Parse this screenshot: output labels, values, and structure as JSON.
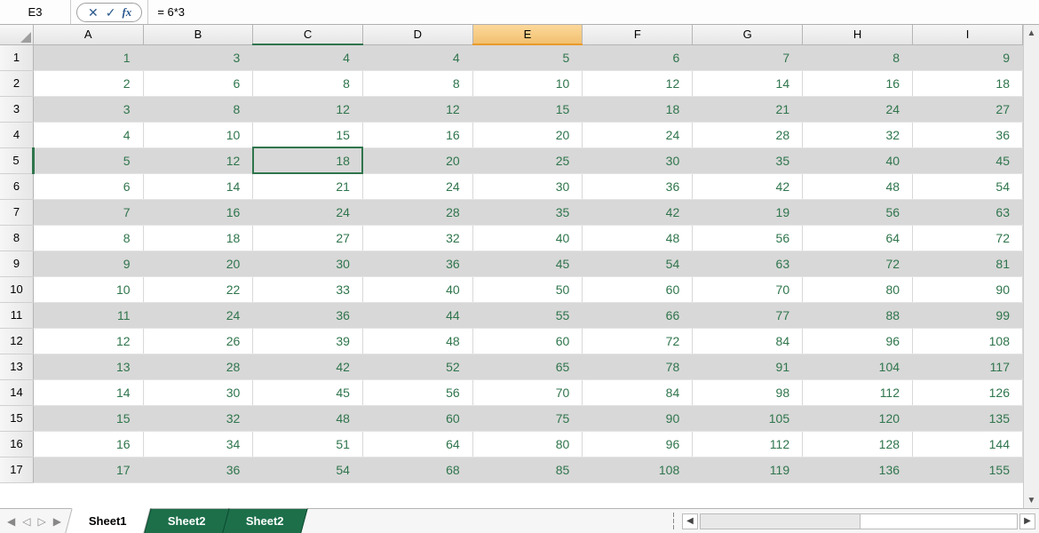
{
  "formulaBar": {
    "cellRef": "E3",
    "fxLabel": "fx",
    "formula": "= 6*3"
  },
  "columns": [
    "A",
    "B",
    "C",
    "D",
    "E",
    "F",
    "G",
    "H",
    "I"
  ],
  "highlightedCol": "E",
  "hintedCol": "C",
  "selectedCell": {
    "row": 5,
    "col": "C"
  },
  "hintedRow": 5,
  "rows": [
    {
      "n": 1,
      "cells": [
        "1",
        "3",
        "4",
        "4",
        "5",
        "6",
        "7",
        "8",
        "9"
      ]
    },
    {
      "n": 2,
      "cells": [
        "2",
        "6",
        "8",
        "8",
        "10",
        "12",
        "14",
        "16",
        "18"
      ]
    },
    {
      "n": 3,
      "cells": [
        "3",
        "8",
        "12",
        "12",
        "15",
        "18",
        "21",
        "24",
        "27"
      ]
    },
    {
      "n": 4,
      "cells": [
        "4",
        "10",
        "15",
        "16",
        "20",
        "24",
        "28",
        "32",
        "36"
      ]
    },
    {
      "n": 5,
      "cells": [
        "5",
        "12",
        "18",
        "20",
        "25",
        "30",
        "35",
        "40",
        "45"
      ]
    },
    {
      "n": 6,
      "cells": [
        "6",
        "14",
        "21",
        "24",
        "30",
        "36",
        "42",
        "48",
        "54"
      ]
    },
    {
      "n": 7,
      "cells": [
        "7",
        "16",
        "24",
        "28",
        "35",
        "42",
        "19",
        "56",
        "63"
      ]
    },
    {
      "n": 8,
      "cells": [
        "8",
        "18",
        "27",
        "32",
        "40",
        "48",
        "56",
        "64",
        "72"
      ]
    },
    {
      "n": 9,
      "cells": [
        "9",
        "20",
        "30",
        "36",
        "45",
        "54",
        "63",
        "72",
        "81"
      ]
    },
    {
      "n": 10,
      "cells": [
        "10",
        "22",
        "33",
        "40",
        "50",
        "60",
        "70",
        "80",
        "90"
      ]
    },
    {
      "n": 11,
      "cells": [
        "11",
        "24",
        "36",
        "44",
        "55",
        "66",
        "77",
        "88",
        "99"
      ]
    },
    {
      "n": 12,
      "cells": [
        "12",
        "26",
        "39",
        "48",
        "60",
        "72",
        "84",
        "96",
        "108"
      ]
    },
    {
      "n": 13,
      "cells": [
        "13",
        "28",
        "42",
        "52",
        "65",
        "78",
        "91",
        "104",
        "117"
      ]
    },
    {
      "n": 14,
      "cells": [
        "14",
        "30",
        "45",
        "56",
        "70",
        "84",
        "98",
        "112",
        "126"
      ]
    },
    {
      "n": 15,
      "cells": [
        "15",
        "32",
        "48",
        "60",
        "75",
        "90",
        "105",
        "120",
        "135"
      ]
    },
    {
      "n": 16,
      "cells": [
        "16",
        "34",
        "51",
        "64",
        "80",
        "96",
        "112",
        "128",
        "144"
      ]
    },
    {
      "n": 17,
      "cells": [
        "17",
        "36",
        "54",
        "68",
        "85",
        "108",
        "119",
        "136",
        "155"
      ]
    }
  ],
  "sheets": [
    {
      "label": "Sheet1",
      "state": "active"
    },
    {
      "label": "Sheet2",
      "state": "selected"
    },
    {
      "label": "Sheet2",
      "state": "selected"
    }
  ],
  "icons": {
    "cancel": "✕",
    "accept": "✓",
    "navFirst": "◀",
    "navPrev": "◁",
    "navNext": "▷",
    "navLast": "▶",
    "scrollUp": "▲",
    "scrollDown": "▼",
    "scrollLeft": "◀",
    "scrollRight": "▶"
  }
}
